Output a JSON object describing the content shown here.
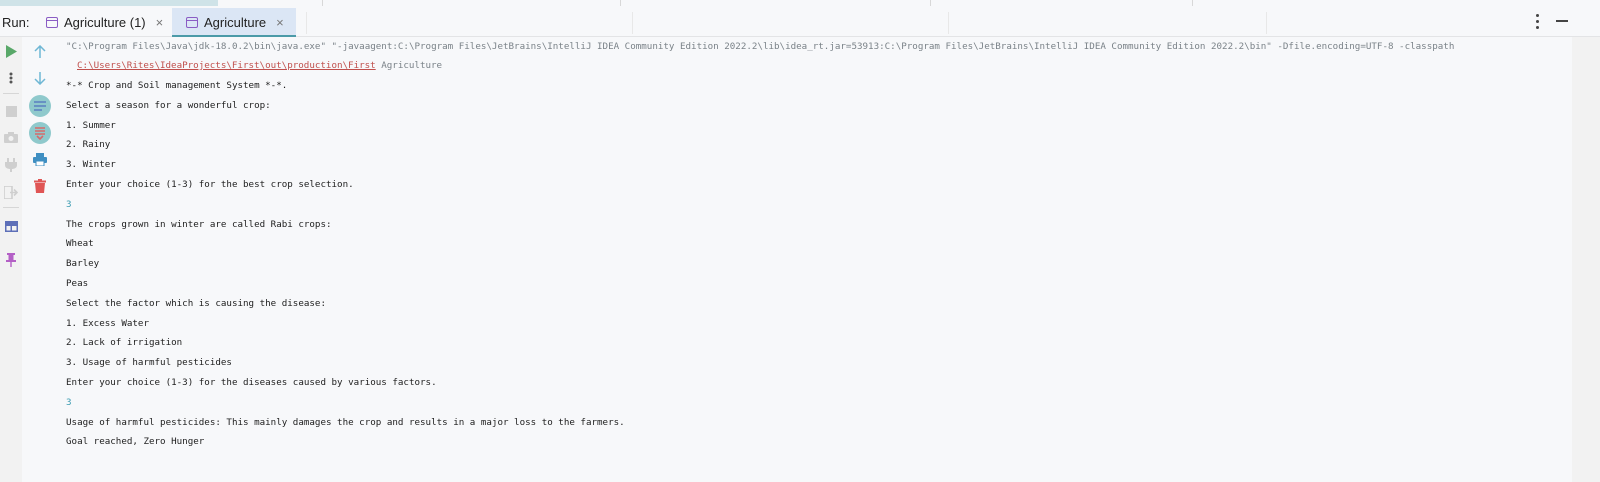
{
  "run_panel": {
    "label": "Run:",
    "tabs": [
      {
        "label": "Agriculture (1)",
        "active": false
      },
      {
        "label": "Agriculture",
        "active": true
      }
    ],
    "close_glyph": "×"
  },
  "toolbar": {
    "left_gutter_icons": [
      "run-icon",
      "more-vertical-icon",
      "stop-icon",
      "camera-icon",
      "plug-icon",
      "exit-icon",
      "layout-icon",
      "pin-icon"
    ],
    "right_gutter_icons": [
      "arrow-up-icon",
      "arrow-down-icon",
      "soft-wrap-icon",
      "scroll-to-end-icon",
      "print-icon",
      "trash-icon"
    ]
  },
  "console": {
    "command_line": "\"C:\\Program Files\\Java\\jdk-18.0.2\\bin\\java.exe\" \"-javaagent:C:\\Program Files\\JetBrains\\IntelliJ IDEA Community Edition 2022.2\\lib\\idea_rt.jar=53913:C:\\Program Files\\JetBrains\\IntelliJ IDEA Community Edition 2022.2\\bin\" -Dfile.encoding=UTF-8 -classpath",
    "classpath_link": "C:\\Users\\Rites\\IdeaProjects\\First\\out\\production\\First",
    "main_class": " Agriculture",
    "output": [
      {
        "text": "*-* Crop and Soil management System *-*.",
        "kind": "out"
      },
      {
        "text": "Select a season for a wonderful crop:",
        "kind": "out"
      },
      {
        "text": "1. Summer",
        "kind": "out"
      },
      {
        "text": "2. Rainy",
        "kind": "out"
      },
      {
        "text": "3. Winter",
        "kind": "out"
      },
      {
        "text": "Enter your choice (1-3) for the best crop selection.",
        "kind": "out"
      },
      {
        "text": "3",
        "kind": "input"
      },
      {
        "text": "The crops grown in winter are called Rabi crops:",
        "kind": "out"
      },
      {
        "text": "Wheat",
        "kind": "out"
      },
      {
        "text": "Barley",
        "kind": "out"
      },
      {
        "text": "Peas",
        "kind": "out"
      },
      {
        "text": "Select the factor which is causing the disease:",
        "kind": "out"
      },
      {
        "text": "1. Excess Water",
        "kind": "out"
      },
      {
        "text": "2. Lack of irrigation",
        "kind": "out"
      },
      {
        "text": "3. Usage of harmful pesticides",
        "kind": "out"
      },
      {
        "text": "Enter your choice (1-3) for the diseases caused by various factors.",
        "kind": "out"
      },
      {
        "text": "3",
        "kind": "input"
      },
      {
        "text": "Usage of harmful pesticides: This mainly damages the crop and results in a major loss to the farmers.",
        "kind": "out"
      },
      {
        "text": "Goal reached, Zero Hunger",
        "kind": "out"
      }
    ]
  },
  "colors": {
    "accent": "#4b9aa8",
    "link": "#c0504d",
    "input_echo": "#3a9ab0",
    "run_green": "#59a869",
    "trash_red": "#e05555"
  }
}
